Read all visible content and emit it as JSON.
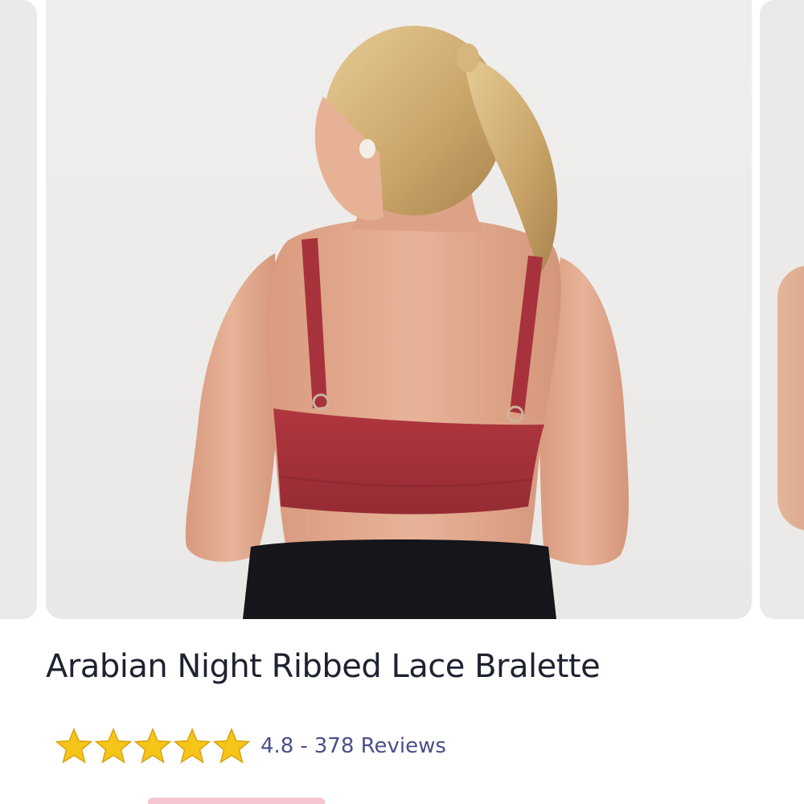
{
  "product": {
    "title": "Arabian Night Ribbed Lace Bralette",
    "image_alt": "Arabian Night Ribbed Lace Bralette - back view",
    "rating": {
      "stars": 5,
      "value": "4.8",
      "separator": "-",
      "reviews_label": "378 Reviews"
    }
  },
  "colors": {
    "title": "#1f2230",
    "rating_text": "#4a4f8a",
    "star": "#f5c518",
    "bralette": "#a8323c",
    "sale_badge": "#f6c6d0"
  },
  "icons": {
    "star": "star-icon"
  }
}
